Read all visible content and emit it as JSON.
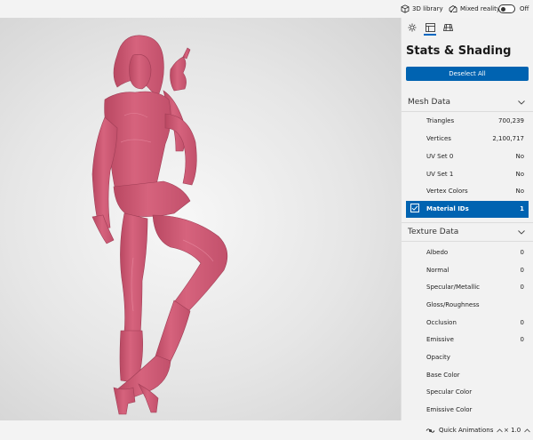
{
  "topbar": {
    "library_label": "3D library",
    "mixed_reality_label": "Mixed reality",
    "toggle_state": "Off"
  },
  "panel": {
    "title": "Stats & Shading",
    "deselect_label": "Deselect All",
    "mesh": {
      "header": "Mesh Data",
      "rows": [
        {
          "label": "Triangles",
          "value": "700,239"
        },
        {
          "label": "Vertices",
          "value": "2,100,717"
        },
        {
          "label": "UV Set 0",
          "value": "No"
        },
        {
          "label": "UV Set 1",
          "value": "No"
        },
        {
          "label": "Vertex Colors",
          "value": "No"
        },
        {
          "label": "Material IDs",
          "value": "1",
          "selected": true
        }
      ]
    },
    "texture": {
      "header": "Texture Data",
      "rows": [
        {
          "label": "Albedo",
          "value": "0"
        },
        {
          "label": "Normal",
          "value": "0"
        },
        {
          "label": "Specular/Metallic",
          "value": "0"
        },
        {
          "label": "Gloss/Roughness",
          "value": ""
        },
        {
          "label": "Occlusion",
          "value": "0"
        },
        {
          "label": "Emissive",
          "value": "0"
        },
        {
          "label": "Opacity",
          "value": ""
        },
        {
          "label": "Base Color",
          "value": ""
        },
        {
          "label": "Specular Color",
          "value": ""
        },
        {
          "label": "Emissive Color",
          "value": ""
        }
      ]
    }
  },
  "bottombar": {
    "animations_label": "Quick Animations",
    "speed_label": "× 1.0"
  },
  "colors": {
    "accent": "#0063b1",
    "model": "#d4607a"
  }
}
